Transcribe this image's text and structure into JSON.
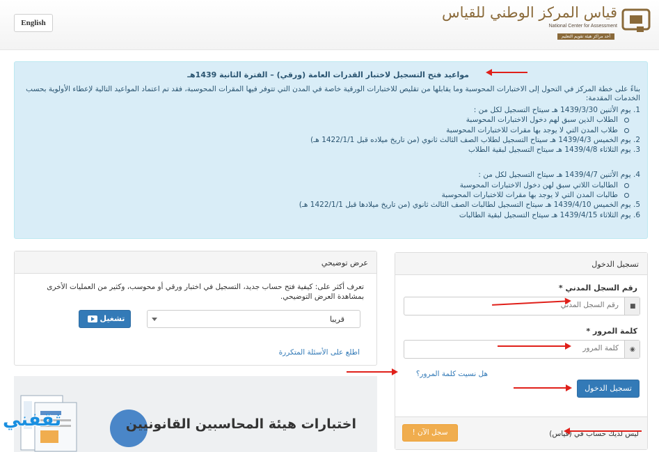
{
  "header": {
    "lang_button": "English",
    "logo_main": "قياس المركز الوطني للقياس",
    "logo_sub": "National Center for Assessment",
    "logo_tag": "أحد مراكز هيئة تقويم التعليم"
  },
  "notice": {
    "title": "مواعيد فتح التسجيل لاختبار القدرات العامة (ورقي) – الفترة الثانية 1439هـ",
    "intro": "بناءً على خطة المركز في التحول إلى الاختبارات المحوسبة وما يقابلها من تقليص للاختبارات الورقية خاصة في المدن التي تتوفر فيها المقرات المحوسبة، فقد تم اعتماد المواعيد التالية لإعطاء الأولوية بحسب الخدمات المقدمة:",
    "items": [
      {
        "n": "1",
        "text": "يوم الأثنين 1439/3/30 هـ سيتاح التسجيل لكل من :"
      },
      {
        "sub": "الطلاب الذين سبق لهم دخول الاختبارات المحوسبة"
      },
      {
        "sub": "طلاب المدن التي لا يوجد بها مقرات للاختبارات المحوسبة"
      },
      {
        "n": "2",
        "text": "يوم الخميس 1439/4/3 هـ سيتاح التسجيل لطلاب الصف الثالث ثانوي (من تاريخ ميلاده قبل 1422/1/1 هـ)"
      },
      {
        "n": "3",
        "text": "يوم الثلاثاء 1439/4/8 هـ سيتاح التسجيل لبقية الطلاب"
      },
      {
        "gap": true
      },
      {
        "n": "4",
        "text": "يوم الأثنين 1439/4/7 هـ سيتاح التسجيل لكل من :"
      },
      {
        "sub": "الطالبات اللاتي سبق لهن دخول الاختبارات المحوسبة"
      },
      {
        "sub": "طالبات المدن التي لا يوجد بها مقرات للاختبارات المحوسبة"
      },
      {
        "n": "5",
        "text": "يوم الخميس 1439/4/10 هـ سيتاح التسجيل لطالبات الصف الثالث ثانوي (من تاريخ ميلادها قبل 1422/1/1 هـ)"
      },
      {
        "n": "6",
        "text": "يوم الثلاثاء 1439/4/15 هـ سيتاح التسجيل لبقية الطالبات"
      }
    ]
  },
  "demo": {
    "heading": "عرض توضيحي",
    "text": "تعرف أكثر على: كيفية فتح حساب جديد، التسجيل في اختبار ورقي أو محوسب، وكثير من العمليات الأخرى بمشاهدة العرض التوضيحي.",
    "select_value": "قريبا",
    "play_label": "تشغيل",
    "faq_link": "اطلع على الأسئلة المتكررة"
  },
  "login": {
    "heading": "تسجيل الدخول",
    "id_label": "رقم السجل المدني *",
    "id_placeholder": "رقم السجل المدني",
    "password_label": "كلمة المرور *",
    "password_placeholder": "كلمة المرور",
    "forgot_link": "هل نسيت كلمة المرور؟",
    "submit": "تسجيل الدخول",
    "signup_question": "ليس لديك حساب في (قياس)",
    "signup_button": "سجل الآن !"
  },
  "banner": {
    "text": "اختبارات هيئة المحاسبين القانونيين"
  },
  "watermark": "ثقفني",
  "colors": {
    "primary": "#337ab7",
    "warning": "#f0ad4e",
    "info_bg": "#d9edf7",
    "annotation_arrow": "#e0201a"
  }
}
